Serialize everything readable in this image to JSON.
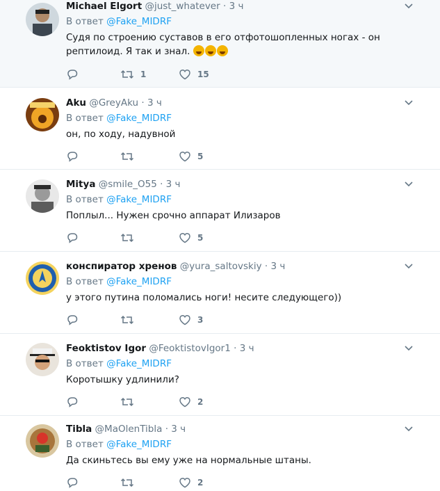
{
  "tweets": [
    {
      "name": "Michael Elgort",
      "handle": "@just_whatever",
      "dot": "·",
      "time": "3 ч",
      "reply_prefix": "В ответ",
      "reply_mention": "@Fake_MIDRF",
      "text": "Судя по строению суставов в его отфотошопленных ногах - он рептилоид. Я так и знал.",
      "emoji_count": 3,
      "retweets": "1",
      "likes": "15",
      "avatar_color": "#5a6b7c"
    },
    {
      "name": "Aku",
      "handle": "@GreyAku",
      "dot": "·",
      "time": "3 ч",
      "reply_prefix": "В ответ",
      "reply_mention": "@Fake_MIDRF",
      "text": "он, по ходу, надувной",
      "retweets": "",
      "likes": "5",
      "avatar_color": "#c47a1e"
    },
    {
      "name": "Mitya",
      "handle": "@smile_O55",
      "dot": "·",
      "time": "3 ч",
      "reply_prefix": "В ответ",
      "reply_mention": "@Fake_MIDRF",
      "text": "Поплыл... Нужен срочно аппарат Илизаров",
      "retweets": "",
      "likes": "5",
      "avatar_color": "#8a8a8a"
    },
    {
      "name": "конспиратор хренов",
      "handle": "@yura_saltovskiy",
      "dot": "·",
      "time": "3 ч",
      "reply_prefix": "В ответ",
      "reply_mention": "@Fake_MIDRF",
      "text": "у этого путина поломались ноги! несите следующего))",
      "retweets": "",
      "likes": "3",
      "avatar_color": "#1f5fae"
    },
    {
      "name": "Feoktistov Igor",
      "handle": "@FeoktistovIgor1",
      "dot": "·",
      "time": "3 ч",
      "reply_prefix": "В ответ",
      "reply_mention": "@Fake_MIDRF",
      "text": "Коротышку удлинили?",
      "retweets": "",
      "likes": "2",
      "avatar_color": "#c9a27c"
    },
    {
      "name": "Tibla",
      "handle": "@MaOlenTibla",
      "dot": "·",
      "time": "3 ч",
      "reply_prefix": "В ответ",
      "reply_mention": "@Fake_MIDRF",
      "text": "Да скиньтесь вы ему уже на нормальные штаны.",
      "retweets": "",
      "likes": "2",
      "avatar_color": "#a8753c"
    }
  ],
  "colors": {
    "link": "#1da1f2",
    "secondary_text": "#657786",
    "primary_text": "#14171a",
    "divider": "#e6ecf0",
    "highlight_bg": "#f5f8fa"
  },
  "icons": {
    "reply": "reply-icon",
    "retweet": "retweet-icon",
    "like": "heart-icon",
    "menu": "chevron-down-icon"
  }
}
